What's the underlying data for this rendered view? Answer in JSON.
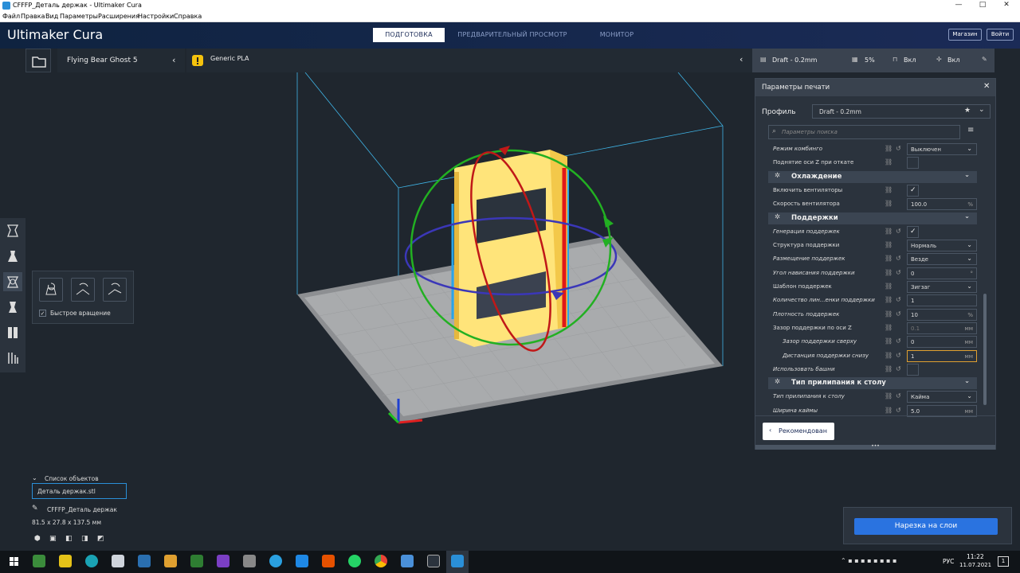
{
  "window": {
    "title": "CFFFP_Деталь держак - Ultimaker Cura",
    "controls": [
      "—",
      "□",
      "✕"
    ]
  },
  "menu": [
    "Файл",
    "Правка",
    "Вид",
    "Параметры",
    "Расширения",
    "Настройки",
    "Справка"
  ],
  "header": {
    "logo": "Ultimaker Cura",
    "stages": [
      "ПОДГОТОВКА",
      "ПРЕДВАРИТЕЛЬНЫЙ ПРОСМОТР",
      "МОНИТОР"
    ],
    "active_stage": "ПОДГОТОВКА",
    "store": "Магазин",
    "login": "Войти"
  },
  "printer": {
    "name": "Flying Bear Ghost 5"
  },
  "material": {
    "name": "Generic PLA"
  },
  "profile_bar": {
    "profile": "Draft - 0.2mm",
    "infill": "5%",
    "support": "Вкл",
    "adhesion": "Вкл"
  },
  "rotate_panel": {
    "snap_label": "Быстрое вращение"
  },
  "objects": {
    "heading": "Список объектов",
    "item": "Деталь держак.stl",
    "name": "CFFFP_Деталь держак",
    "dims": "81.5 x 27.8 x 137.5 мм"
  },
  "settings": {
    "title": "Параметры печати",
    "profile_label": "Профиль",
    "profile_value": "Draft - 0.2mm",
    "search_placeholder": "Параметры поиска",
    "recommended": "Рекомендован",
    "rows": [
      {
        "label": "Режим комбинго",
        "value": "Выключен"
      },
      {
        "label": "Поднятие оси Z при откате",
        "value": ""
      },
      {
        "category": "Охлаждение"
      },
      {
        "label": "Включить вентиляторы",
        "value": "✓"
      },
      {
        "label": "Скорость вентилятора",
        "value": "100.0",
        "unit": "%"
      },
      {
        "category": "Поддержки"
      },
      {
        "label": "Генерация поддержек",
        "value": "✓"
      },
      {
        "label": "Структура поддержки",
        "value": "Нормаль"
      },
      {
        "label": "Размещение поддержек",
        "value": "Везде"
      },
      {
        "label": "Угол нависания поддержки",
        "value": "0",
        "unit": "°"
      },
      {
        "label": "Шаблон поддержек",
        "value": "Зигзаг"
      },
      {
        "label": "Количество лин...енки поддержки",
        "value": "1"
      },
      {
        "label": "Плотность поддержек",
        "value": "10",
        "unit": "%"
      },
      {
        "label": "Зазор поддержки по оси Z",
        "value": "0.1",
        "unit": "мм"
      },
      {
        "label": "Зазор поддержки сверху",
        "value": "0",
        "unit": "мм"
      },
      {
        "label": "Дистанция поддержки снизу",
        "value": "1",
        "unit": "мм"
      },
      {
        "label": "Использовать башни",
        "value": ""
      },
      {
        "category": "Тип прилипания к столу"
      },
      {
        "label": "Тип прилипания к столу",
        "value": "Кайма"
      },
      {
        "label": "Ширина каймы",
        "value": "5.0",
        "unit": "мм"
      }
    ]
  },
  "slice_button": "Нарезка на слои",
  "tray": {
    "lang": "РУС",
    "time": "11:22",
    "date": "11.07.2021",
    "notif": "1"
  },
  "colors": {
    "accent": "#2a73e0",
    "model": "#ffe47a",
    "header": "#1b2b57"
  }
}
